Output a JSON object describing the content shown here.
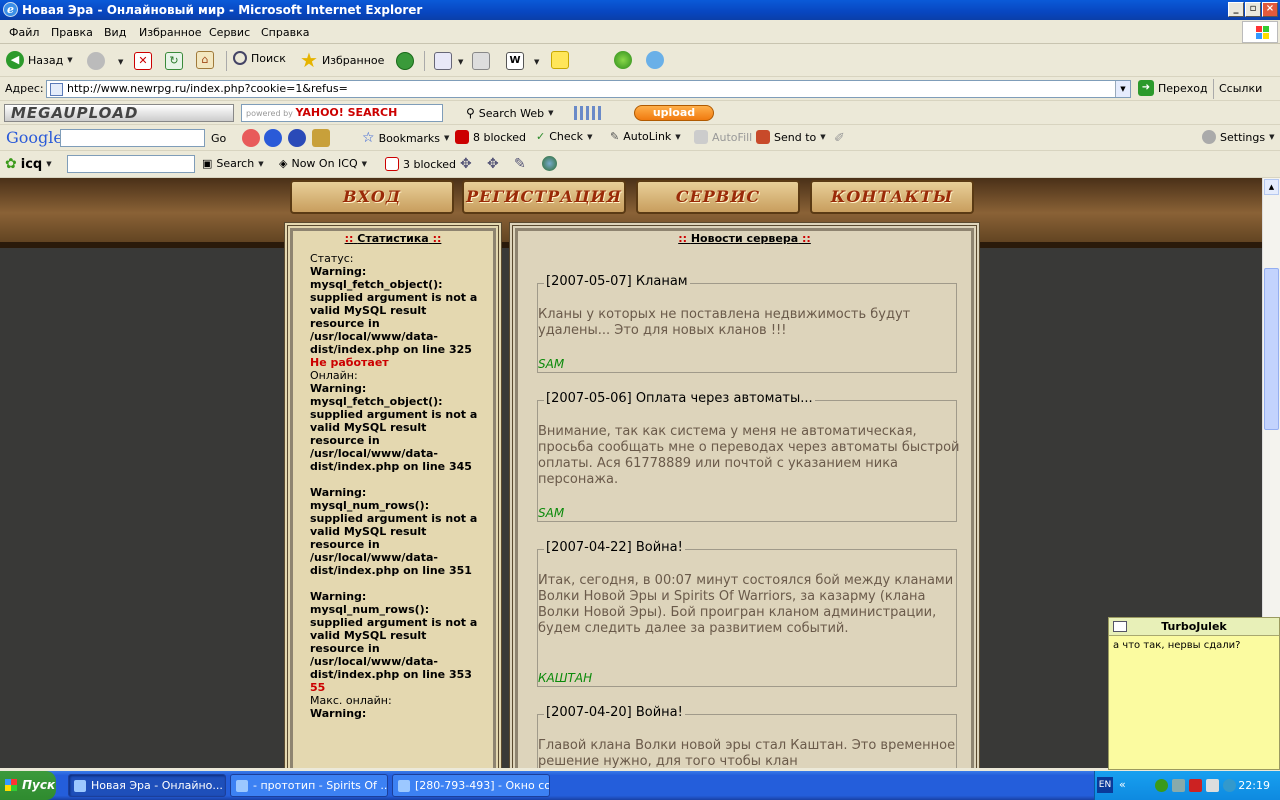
{
  "window": {
    "title": "Новая Эра - Онлайновый мир - Microsoft Internet Explorer"
  },
  "menu": [
    "Файл",
    "Правка",
    "Вид",
    "Избранное",
    "Сервис",
    "Справка"
  ],
  "toolbar": {
    "back": "Назад",
    "search": "Поиск",
    "favorites": "Избранное"
  },
  "address": {
    "label": "Адрес:",
    "url": "http://www.newrpg.ru/index.php?cookie=1&refus=",
    "go": "Переход",
    "links": "Ссылки"
  },
  "megaupload": {
    "logo": "MEGAUPLOAD",
    "powered": "powered by",
    "yahoo": "YAHOO! SEARCH",
    "search_web": "Search Web",
    "upload": "upload"
  },
  "google": {
    "logo": "Google",
    "go": "Go",
    "bookmarks": "Bookmarks",
    "blocked": "8 blocked",
    "check": "Check",
    "autolink": "AutoLink",
    "autofill": "AutoFill",
    "sendto": "Send to",
    "settings": "Settings"
  },
  "icqbar": {
    "logo": "icq",
    "search": "Search",
    "now_on_icq": "Now On ICQ",
    "blocked": "3 blocked"
  },
  "site": {
    "nav": [
      "ВХОД",
      "РЕГИСТРАЦИЯ",
      "СЕРВИС",
      "КОНТАКТЫ"
    ],
    "stats": {
      "title": "Статистика",
      "status_label": "Статус:",
      "warn1": "Warning: mysql_fetch_object(): supplied argument is not a valid MySQL result resource in /usr/local/www/data-dist/index.php on line 325",
      "status_value": "Не работает",
      "online_label": "Онлайн:",
      "warn2": "Warning: mysql_fetch_object(): supplied argument is not a valid MySQL result resource in /usr/local/www/data-dist/index.php on line 345",
      "warn3": "Warning: mysql_num_rows(): supplied argument is not a valid MySQL result resource in /usr/local/www/data-dist/index.php on line 351",
      "warn4": "Warning: mysql_num_rows(): supplied argument is not a valid MySQL result resource in /usr/local/www/data-dist/index.php on line 353",
      "online_value": "55",
      "max_label": "Макс. онлайн:",
      "warn5": "Warning:"
    },
    "news_title": "Новости сервера",
    "news": [
      {
        "head": "[2007-05-07] Кланам",
        "body": "Кланы у которых не поставлена недвижимость будут удалены... Это для новых кланов !!!",
        "author": "SAM"
      },
      {
        "head": "[2007-05-06] Оплата через автоматы...",
        "body": "Внимание, так как система у меня не автоматическая, просьба сообщать мне о переводах через автоматы быстрой оплаты. Ася 61778889 или почтой с указанием ника персонажа.",
        "author": "SAM"
      },
      {
        "head": "[2007-04-22] Война!",
        "body": "Итак, сегодня, в 00:07 минут состоялся бой между кланами Волки Новой Эры и Spirits Of Warriors, за казарму (клана Волки Новой Эры). Бой проигран кланом администрации, будем следить далее за развитием событий.",
        "author": "КАШТАН"
      },
      {
        "head": "[2007-04-20] Война!",
        "body": "Главой клана Волки новой эры стал Каштан. Это временное решение нужно, для того чтобы клан",
        "author": ""
      }
    ]
  },
  "chat": {
    "name": "TurboJulek",
    "message": "а что так, нервы сдали?"
  },
  "taskbar": {
    "start": "Пуск",
    "tasks": [
      "Новая Эра - Онлайно...",
      "- прототип - Spirits Of ...",
      "[280-793-493] - Окно со..."
    ],
    "lang": "EN",
    "clock": "22:19"
  }
}
